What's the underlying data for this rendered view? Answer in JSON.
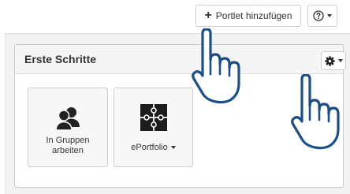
{
  "toolbar": {
    "add_portlet_label": "Portlet hinzufügen",
    "add_icon": "plus-icon",
    "help_icon": "question-circle-icon"
  },
  "portlet": {
    "title": "Erste Schritte",
    "settings_icon": "gear-icon",
    "tiles": [
      {
        "label": "In Gruppen arbeiten",
        "icon": "users-icon"
      },
      {
        "label": "ePortfolio",
        "icon": "puzzle-icon",
        "has_dropdown": true
      }
    ]
  },
  "colors": {
    "page_background": "#f2f2f2",
    "panel_header": "#f5f5f5",
    "tile_background": "#f7f7f7",
    "icon": "#222222"
  }
}
